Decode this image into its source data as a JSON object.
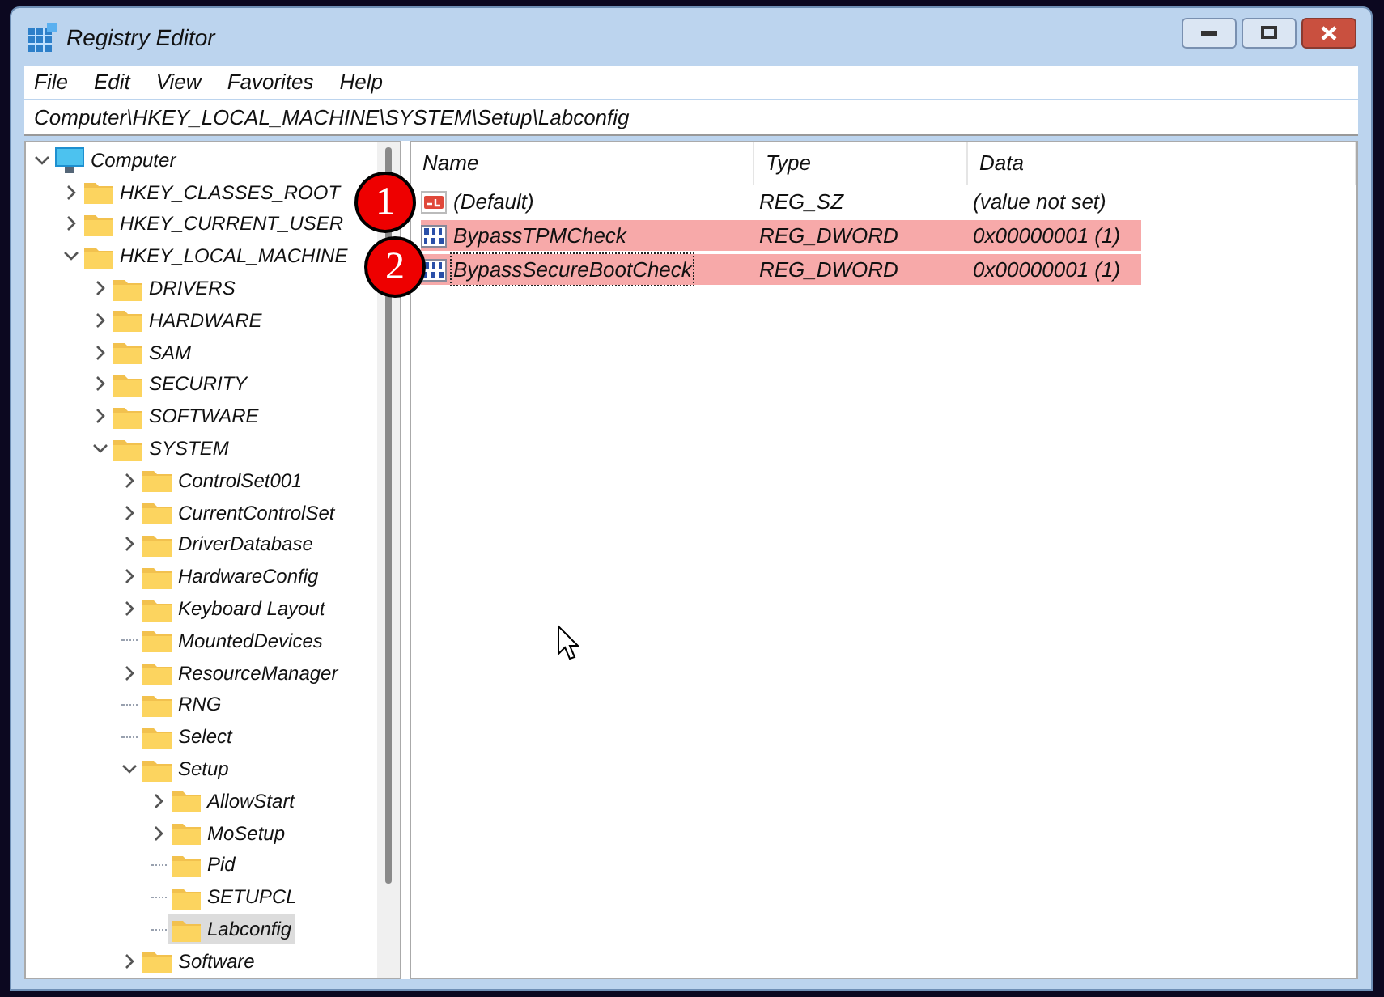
{
  "window": {
    "title": "Registry Editor"
  },
  "menu": [
    "File",
    "Edit",
    "View",
    "Favorites",
    "Help"
  ],
  "address": "Computer\\HKEY_LOCAL_MACHINE\\SYSTEM\\Setup\\Labconfig",
  "tree": [
    {
      "label": "Computer",
      "kind": "computer",
      "expandable": true,
      "expanded": true,
      "selected": false,
      "children": [
        {
          "label": "HKEY_CLASSES_ROOT",
          "kind": "folder",
          "expandable": true,
          "expanded": false,
          "selected": false
        },
        {
          "label": "HKEY_CURRENT_USER",
          "kind": "folder",
          "expandable": true,
          "expanded": false,
          "selected": false
        },
        {
          "label": "HKEY_LOCAL_MACHINE",
          "kind": "folder",
          "expandable": true,
          "expanded": true,
          "selected": false,
          "children": [
            {
              "label": "DRIVERS",
              "kind": "folder",
              "expandable": true,
              "expanded": false,
              "selected": false
            },
            {
              "label": "HARDWARE",
              "kind": "folder",
              "expandable": true,
              "expanded": false,
              "selected": false
            },
            {
              "label": "SAM",
              "kind": "folder",
              "expandable": true,
              "expanded": false,
              "selected": false
            },
            {
              "label": "SECURITY",
              "kind": "folder",
              "expandable": true,
              "expanded": false,
              "selected": false
            },
            {
              "label": "SOFTWARE",
              "kind": "folder",
              "expandable": true,
              "expanded": false,
              "selected": false
            },
            {
              "label": "SYSTEM",
              "kind": "folder",
              "expandable": true,
              "expanded": true,
              "selected": false,
              "children": [
                {
                  "label": "ControlSet001",
                  "kind": "folder",
                  "expandable": true,
                  "expanded": false,
                  "selected": false
                },
                {
                  "label": "CurrentControlSet",
                  "kind": "folder",
                  "expandable": true,
                  "expanded": false,
                  "selected": false
                },
                {
                  "label": "DriverDatabase",
                  "kind": "folder",
                  "expandable": true,
                  "expanded": false,
                  "selected": false
                },
                {
                  "label": "HardwareConfig",
                  "kind": "folder",
                  "expandable": true,
                  "expanded": false,
                  "selected": false
                },
                {
                  "label": "Keyboard Layout",
                  "kind": "folder",
                  "expandable": true,
                  "expanded": false,
                  "selected": false
                },
                {
                  "label": "MountedDevices",
                  "kind": "folder",
                  "expandable": false,
                  "selected": false
                },
                {
                  "label": "ResourceManager",
                  "kind": "folder",
                  "expandable": true,
                  "expanded": false,
                  "selected": false
                },
                {
                  "label": "RNG",
                  "kind": "folder",
                  "expandable": false,
                  "selected": false
                },
                {
                  "label": "Select",
                  "kind": "folder",
                  "expandable": false,
                  "selected": false
                },
                {
                  "label": "Setup",
                  "kind": "folder",
                  "expandable": true,
                  "expanded": true,
                  "selected": false,
                  "children": [
                    {
                      "label": "AllowStart",
                      "kind": "folder",
                      "expandable": true,
                      "expanded": false,
                      "selected": false
                    },
                    {
                      "label": "MoSetup",
                      "kind": "folder",
                      "expandable": true,
                      "expanded": false,
                      "selected": false
                    },
                    {
                      "label": "Pid",
                      "kind": "folder",
                      "expandable": false,
                      "selected": false
                    },
                    {
                      "label": "SETUPCL",
                      "kind": "folder",
                      "expandable": false,
                      "selected": false
                    },
                    {
                      "label": "Labconfig",
                      "kind": "folder",
                      "expandable": false,
                      "selected": true
                    }
                  ]
                },
                {
                  "label": "Software",
                  "kind": "folder",
                  "expandable": true,
                  "expanded": false,
                  "selected": false
                }
              ]
            }
          ]
        }
      ]
    }
  ],
  "table": {
    "columns": [
      "Name",
      "Type",
      "Data"
    ],
    "rows": [
      {
        "kind": "string",
        "name": "(Default)",
        "type": "REG_SZ",
        "data": "(value not set)",
        "highlighted": false,
        "focused": false
      },
      {
        "kind": "dword",
        "name": "BypassTPMCheck",
        "type": "REG_DWORD",
        "data": "0x00000001 (1)",
        "highlighted": true,
        "focused": false
      },
      {
        "kind": "dword",
        "name": "BypassSecureBootCheck",
        "type": "REG_DWORD",
        "data": "0x00000001 (1)",
        "highlighted": true,
        "focused": true
      }
    ]
  },
  "annotations": [
    {
      "label": "1"
    },
    {
      "label": "2"
    }
  ]
}
